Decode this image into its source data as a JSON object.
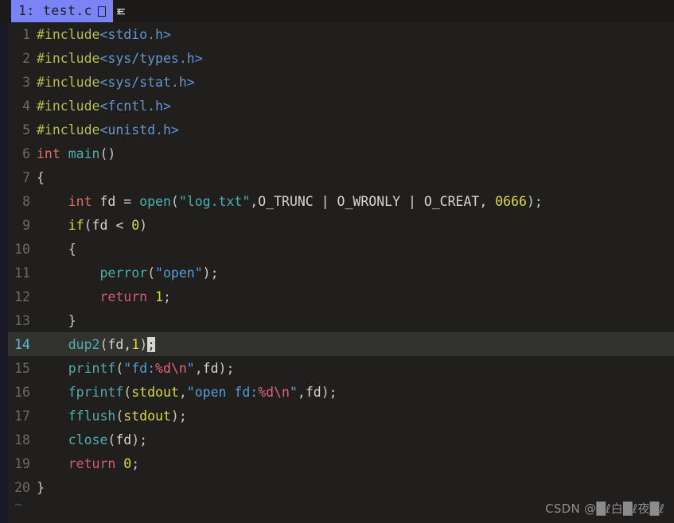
{
  "window": {
    "bg_color": "#211f1d",
    "app_kind": "vim-terminal-editor"
  },
  "tabline": {
    "bg_color": "#1b1a18",
    "active_tab": {
      "label": "1: test.c",
      "modified_glyph": "□",
      "bg_color": "#7b84f5",
      "fg_color": "#1c1c2a"
    },
    "trailing_icon": "tab-indent-icon"
  },
  "gutter": {
    "sign_column_color": "#191a25",
    "line_number_color": "#6a6a66",
    "cursor_line_number_color": "#61b8d8"
  },
  "cursor": {
    "line": 14,
    "column_char": ";",
    "cursorline_bg": "#32322f"
  },
  "colors": {
    "preprocessor": "#b5bd4b",
    "include_path": "#6196cf",
    "type": "#e06c62",
    "function": "#4ab0b0",
    "string": "#5b9bd5",
    "number": "#d8d84b",
    "keyword": "#d8d84b",
    "return_keyword": "#d9547f",
    "format_spec": "#e0647a",
    "identifier": "#d6d6cc"
  },
  "code": {
    "filename": "test.c",
    "total_lines": 20,
    "empty_marker": "~",
    "lines": [
      {
        "n": "1",
        "text": "#include<stdio.h>"
      },
      {
        "n": "2",
        "text": "#include<sys/types.h>"
      },
      {
        "n": "3",
        "text": "#include<sys/stat.h>"
      },
      {
        "n": "4",
        "text": "#include<fcntl.h>"
      },
      {
        "n": "5",
        "text": "#include<unistd.h>"
      },
      {
        "n": "6",
        "text": "int main()"
      },
      {
        "n": "7",
        "text": "{"
      },
      {
        "n": "8",
        "text": "    int fd = open(\"log.txt\",O_TRUNC | O_WRONLY | O_CREAT, 0666);"
      },
      {
        "n": "9",
        "text": "    if(fd < 0)"
      },
      {
        "n": "10",
        "text": "    {"
      },
      {
        "n": "11",
        "text": "        perror(\"open\");"
      },
      {
        "n": "12",
        "text": "        return 1;"
      },
      {
        "n": "13",
        "text": "    }"
      },
      {
        "n": "14",
        "text": "    dup2(fd,1);"
      },
      {
        "n": "15",
        "text": "    printf(\"fd:%d\\n\",fd);"
      },
      {
        "n": "16",
        "text": "    fprintf(stdout,\"open fd:%d\\n\",fd);"
      },
      {
        "n": "17",
        "text": "    fflush(stdout);"
      },
      {
        "n": "18",
        "text": "    close(fd);"
      },
      {
        "n": "19",
        "text": "    return 0;"
      },
      {
        "n": "20",
        "text": "}"
      }
    ]
  },
  "watermark": {
    "text": "CSDN @█ℓ白█ℓ夜█ℓ"
  }
}
